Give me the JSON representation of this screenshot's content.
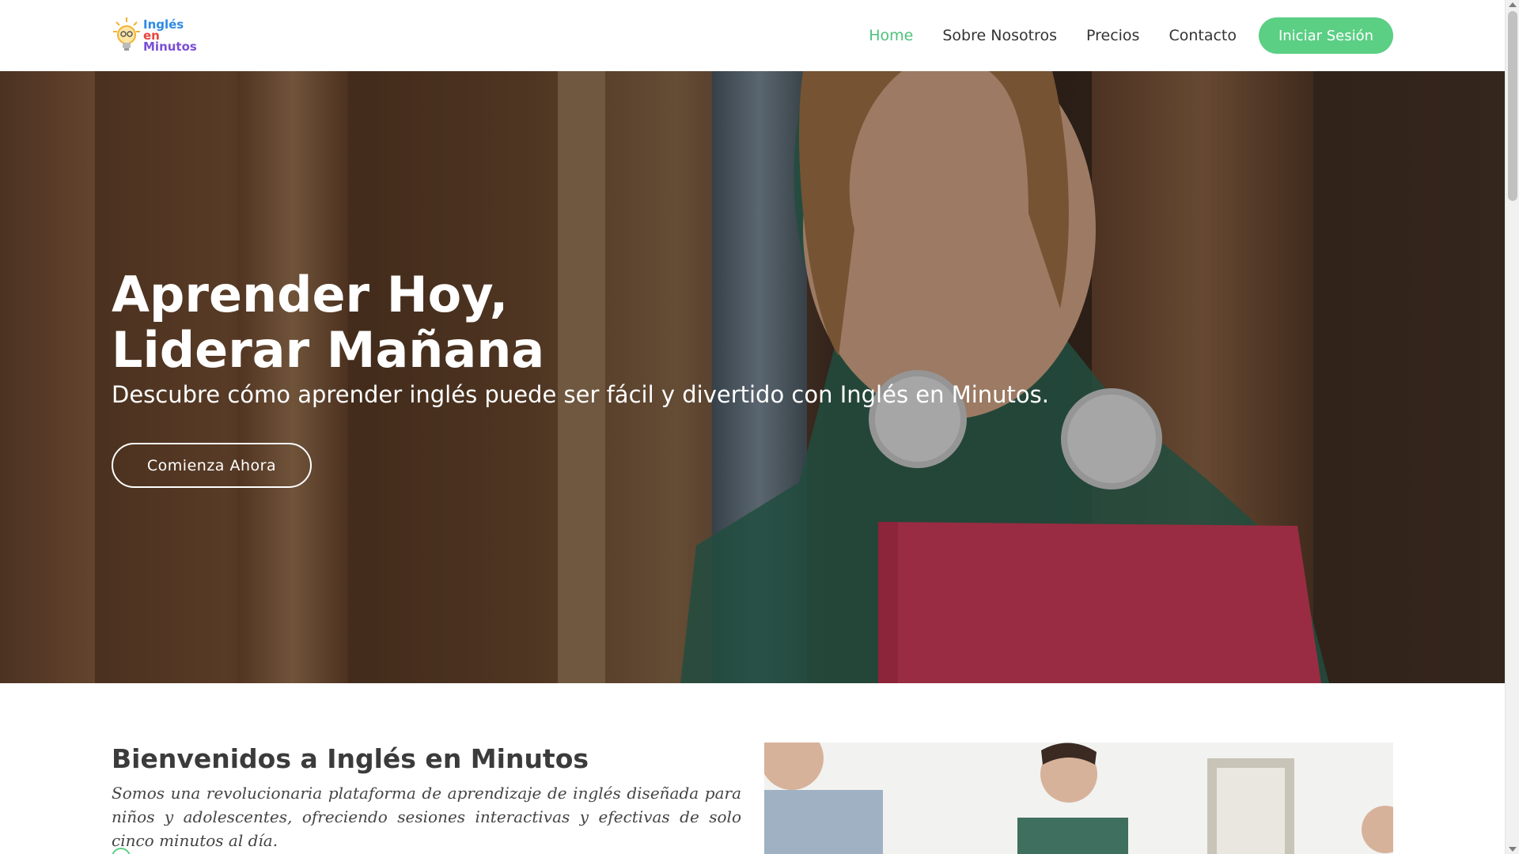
{
  "header": {
    "logo": {
      "line1": "Inglés",
      "line2": "en",
      "line3": "Minutos"
    },
    "nav": [
      "Home",
      "Sobre Nosotros",
      "Precios",
      "Contacto"
    ],
    "login_label": "Iniciar Sesión"
  },
  "hero": {
    "title_line1": "Aprender Hoy,",
    "title_line2": "Liderar Mañana",
    "subtitle": "Descubre cómo aprender inglés puede ser fácil y divertido con Inglés en Minutos.",
    "cta_label": "Comienza Ahora"
  },
  "welcome": {
    "title": "Bienvenidos a Inglés en Minutos",
    "text": "Somos una revolucionaria plataforma de aprendizaje de inglés diseñada para niños y adolescentes, ofreciendo sesiones interactivas y efectivas de solo cinco minutos al día."
  },
  "colors": {
    "accent": "#5bcf84",
    "nav_active": "#4ec27a"
  },
  "icons": {
    "logo": "lightbulb-icon",
    "list_bullet": "check-circle-icon"
  }
}
